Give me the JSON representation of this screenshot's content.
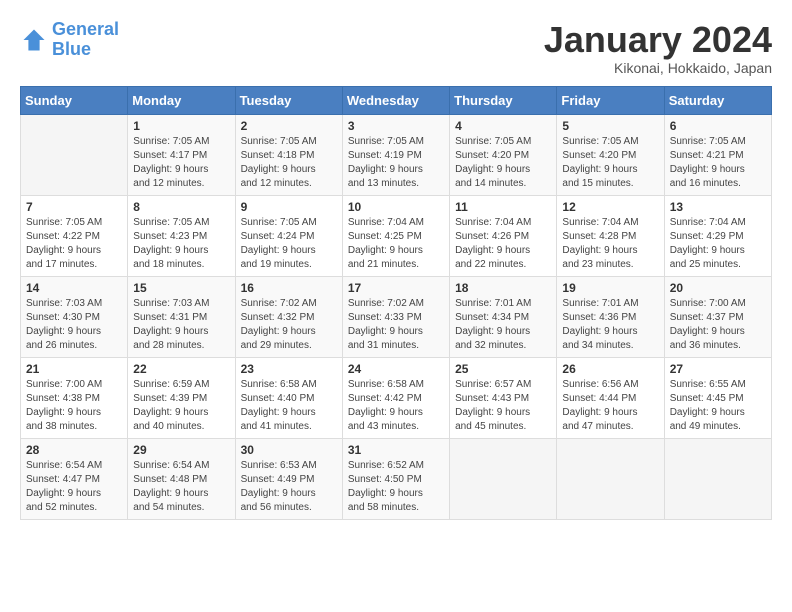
{
  "header": {
    "logo_line1": "General",
    "logo_line2": "Blue",
    "title": "January 2024",
    "location": "Kikonai, Hokkaido, Japan"
  },
  "days_of_week": [
    "Sunday",
    "Monday",
    "Tuesday",
    "Wednesday",
    "Thursday",
    "Friday",
    "Saturday"
  ],
  "weeks": [
    [
      {
        "num": "",
        "info": ""
      },
      {
        "num": "1",
        "info": "Sunrise: 7:05 AM\nSunset: 4:17 PM\nDaylight: 9 hours\nand 12 minutes."
      },
      {
        "num": "2",
        "info": "Sunrise: 7:05 AM\nSunset: 4:18 PM\nDaylight: 9 hours\nand 12 minutes."
      },
      {
        "num": "3",
        "info": "Sunrise: 7:05 AM\nSunset: 4:19 PM\nDaylight: 9 hours\nand 13 minutes."
      },
      {
        "num": "4",
        "info": "Sunrise: 7:05 AM\nSunset: 4:20 PM\nDaylight: 9 hours\nand 14 minutes."
      },
      {
        "num": "5",
        "info": "Sunrise: 7:05 AM\nSunset: 4:20 PM\nDaylight: 9 hours\nand 15 minutes."
      },
      {
        "num": "6",
        "info": "Sunrise: 7:05 AM\nSunset: 4:21 PM\nDaylight: 9 hours\nand 16 minutes."
      }
    ],
    [
      {
        "num": "7",
        "info": "Sunrise: 7:05 AM\nSunset: 4:22 PM\nDaylight: 9 hours\nand 17 minutes."
      },
      {
        "num": "8",
        "info": "Sunrise: 7:05 AM\nSunset: 4:23 PM\nDaylight: 9 hours\nand 18 minutes."
      },
      {
        "num": "9",
        "info": "Sunrise: 7:05 AM\nSunset: 4:24 PM\nDaylight: 9 hours\nand 19 minutes."
      },
      {
        "num": "10",
        "info": "Sunrise: 7:04 AM\nSunset: 4:25 PM\nDaylight: 9 hours\nand 21 minutes."
      },
      {
        "num": "11",
        "info": "Sunrise: 7:04 AM\nSunset: 4:26 PM\nDaylight: 9 hours\nand 22 minutes."
      },
      {
        "num": "12",
        "info": "Sunrise: 7:04 AM\nSunset: 4:28 PM\nDaylight: 9 hours\nand 23 minutes."
      },
      {
        "num": "13",
        "info": "Sunrise: 7:04 AM\nSunset: 4:29 PM\nDaylight: 9 hours\nand 25 minutes."
      }
    ],
    [
      {
        "num": "14",
        "info": "Sunrise: 7:03 AM\nSunset: 4:30 PM\nDaylight: 9 hours\nand 26 minutes."
      },
      {
        "num": "15",
        "info": "Sunrise: 7:03 AM\nSunset: 4:31 PM\nDaylight: 9 hours\nand 28 minutes."
      },
      {
        "num": "16",
        "info": "Sunrise: 7:02 AM\nSunset: 4:32 PM\nDaylight: 9 hours\nand 29 minutes."
      },
      {
        "num": "17",
        "info": "Sunrise: 7:02 AM\nSunset: 4:33 PM\nDaylight: 9 hours\nand 31 minutes."
      },
      {
        "num": "18",
        "info": "Sunrise: 7:01 AM\nSunset: 4:34 PM\nDaylight: 9 hours\nand 32 minutes."
      },
      {
        "num": "19",
        "info": "Sunrise: 7:01 AM\nSunset: 4:36 PM\nDaylight: 9 hours\nand 34 minutes."
      },
      {
        "num": "20",
        "info": "Sunrise: 7:00 AM\nSunset: 4:37 PM\nDaylight: 9 hours\nand 36 minutes."
      }
    ],
    [
      {
        "num": "21",
        "info": "Sunrise: 7:00 AM\nSunset: 4:38 PM\nDaylight: 9 hours\nand 38 minutes."
      },
      {
        "num": "22",
        "info": "Sunrise: 6:59 AM\nSunset: 4:39 PM\nDaylight: 9 hours\nand 40 minutes."
      },
      {
        "num": "23",
        "info": "Sunrise: 6:58 AM\nSunset: 4:40 PM\nDaylight: 9 hours\nand 41 minutes."
      },
      {
        "num": "24",
        "info": "Sunrise: 6:58 AM\nSunset: 4:42 PM\nDaylight: 9 hours\nand 43 minutes."
      },
      {
        "num": "25",
        "info": "Sunrise: 6:57 AM\nSunset: 4:43 PM\nDaylight: 9 hours\nand 45 minutes."
      },
      {
        "num": "26",
        "info": "Sunrise: 6:56 AM\nSunset: 4:44 PM\nDaylight: 9 hours\nand 47 minutes."
      },
      {
        "num": "27",
        "info": "Sunrise: 6:55 AM\nSunset: 4:45 PM\nDaylight: 9 hours\nand 49 minutes."
      }
    ],
    [
      {
        "num": "28",
        "info": "Sunrise: 6:54 AM\nSunset: 4:47 PM\nDaylight: 9 hours\nand 52 minutes."
      },
      {
        "num": "29",
        "info": "Sunrise: 6:54 AM\nSunset: 4:48 PM\nDaylight: 9 hours\nand 54 minutes."
      },
      {
        "num": "30",
        "info": "Sunrise: 6:53 AM\nSunset: 4:49 PM\nDaylight: 9 hours\nand 56 minutes."
      },
      {
        "num": "31",
        "info": "Sunrise: 6:52 AM\nSunset: 4:50 PM\nDaylight: 9 hours\nand 58 minutes."
      },
      {
        "num": "",
        "info": ""
      },
      {
        "num": "",
        "info": ""
      },
      {
        "num": "",
        "info": ""
      }
    ]
  ]
}
